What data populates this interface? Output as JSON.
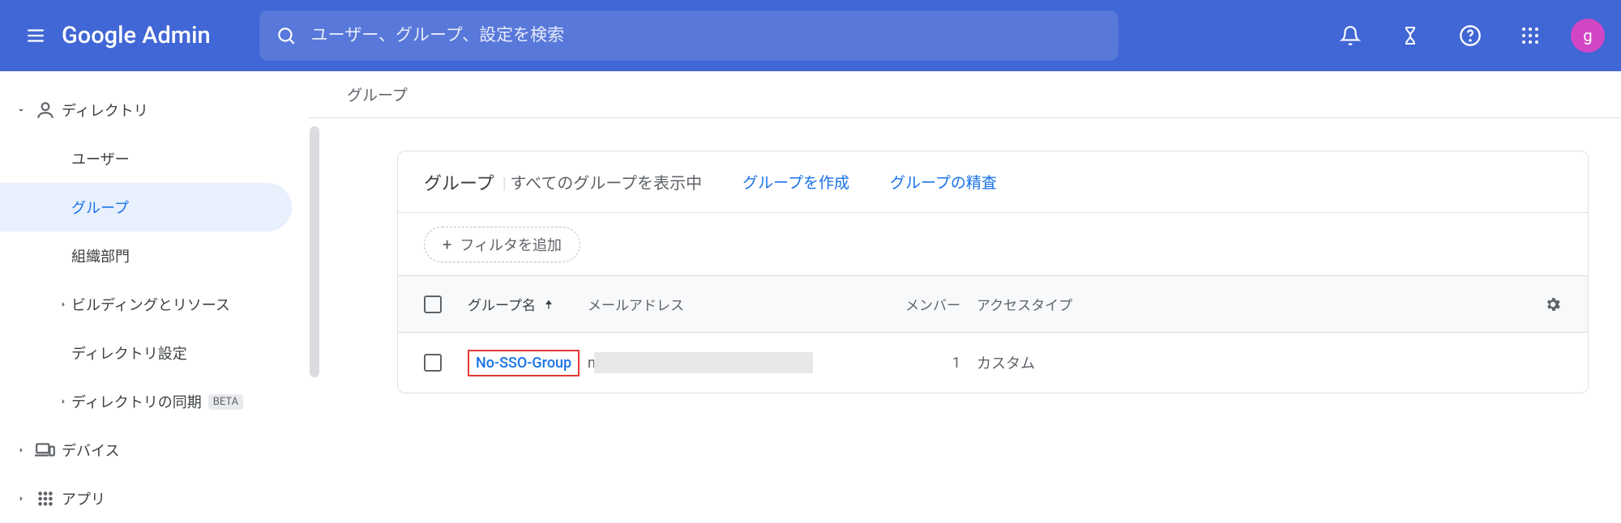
{
  "header": {
    "logo": "Google Admin",
    "search_placeholder": "ユーザー、グループ、設定を検索",
    "avatar_letter": "g"
  },
  "sidebar": {
    "directory": "ディレクトリ",
    "users": "ユーザー",
    "groups": "グループ",
    "org_units": "組織部門",
    "buildings": "ビルディングとリソース",
    "dir_settings": "ディレクトリ設定",
    "dir_sync": "ディレクトリの同期",
    "beta": "BETA",
    "devices": "デバイス",
    "apps": "アプリ"
  },
  "main": {
    "breadcrumb": "グループ",
    "panel_title": "グループ",
    "panel_sub": "すべてのグループを表示中",
    "create_group": "グループを作成",
    "inspect_group": "グループの精査",
    "add_filter": "フィルタを追加",
    "columns": {
      "name": "グループ名",
      "email": "メールアドレス",
      "members": "メンバー",
      "access": "アクセスタイプ"
    },
    "rows": [
      {
        "name": "No-SSO-Group",
        "email_prefix": "n",
        "members": "1",
        "access": "カスタム"
      }
    ]
  }
}
